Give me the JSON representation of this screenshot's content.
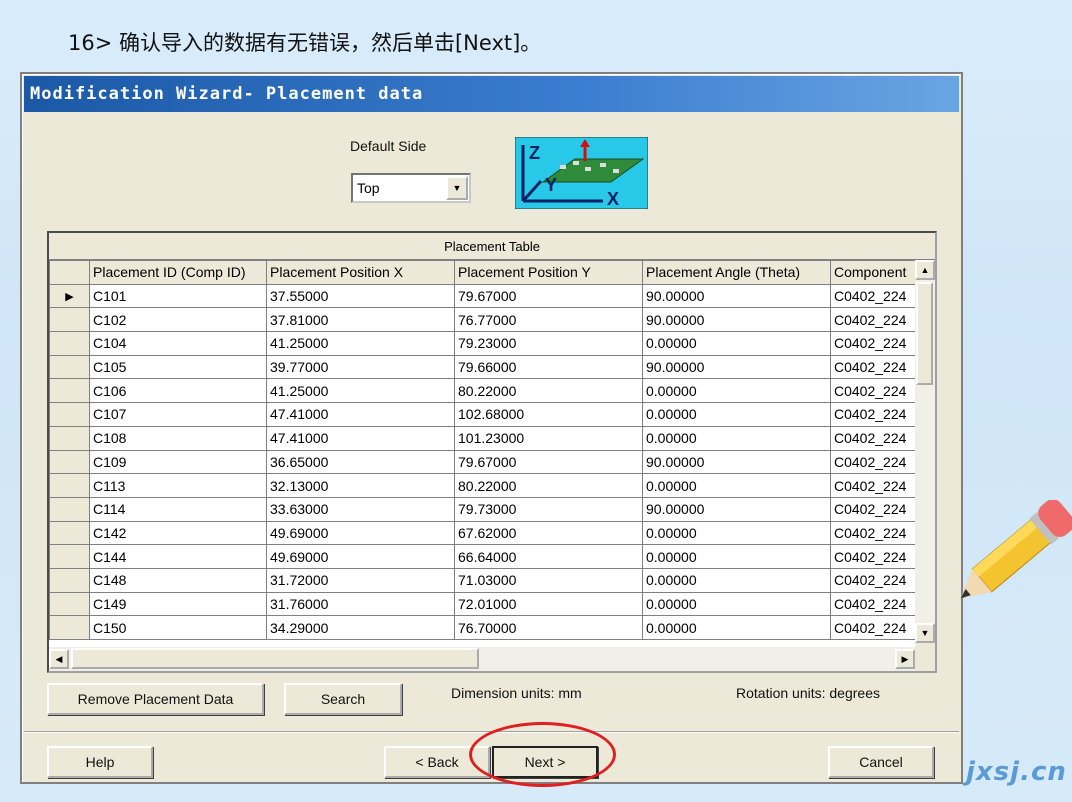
{
  "caption": "16> 确认导入的数据有无错误，然后单击[Next]。",
  "dialog": {
    "title": "Modification Wizard- Placement data",
    "default_side_label": "Default Side",
    "default_side_value": "Top",
    "axis_icon_labels": {
      "z": "Z",
      "y": "Y",
      "x": "X"
    }
  },
  "table": {
    "caption": "Placement Table",
    "columns": [
      "Placement ID (Comp ID)",
      "Placement Position X",
      "Placement Position Y",
      "Placement Angle (Theta)",
      "Component"
    ],
    "rows": [
      [
        "C101",
        "37.55000",
        "79.67000",
        "90.00000",
        "C0402_224"
      ],
      [
        "C102",
        "37.81000",
        "76.77000",
        "90.00000",
        "C0402_224"
      ],
      [
        "C104",
        "41.25000",
        "79.23000",
        "0.00000",
        "C0402_224"
      ],
      [
        "C105",
        "39.77000",
        "79.66000",
        "90.00000",
        "C0402_224"
      ],
      [
        "C106",
        "41.25000",
        "80.22000",
        "0.00000",
        "C0402_224"
      ],
      [
        "C107",
        "47.41000",
        "102.68000",
        "0.00000",
        "C0402_224"
      ],
      [
        "C108",
        "47.41000",
        "101.23000",
        "0.00000",
        "C0402_224"
      ],
      [
        "C109",
        "36.65000",
        "79.67000",
        "90.00000",
        "C0402_224"
      ],
      [
        "C113",
        "32.13000",
        "80.22000",
        "0.00000",
        "C0402_224"
      ],
      [
        "C114",
        "33.63000",
        "79.73000",
        "90.00000",
        "C0402_224"
      ],
      [
        "C142",
        "49.69000",
        "67.62000",
        "0.00000",
        "C0402_224"
      ],
      [
        "C144",
        "49.69000",
        "66.64000",
        "0.00000",
        "C0402_224"
      ],
      [
        "C148",
        "31.72000",
        "71.03000",
        "0.00000",
        "C0402_224"
      ],
      [
        "C149",
        "31.76000",
        "72.01000",
        "0.00000",
        "C0402_224"
      ],
      [
        "C150",
        "34.29000",
        "76.70000",
        "0.00000",
        "C0402_224"
      ]
    ]
  },
  "buttons": {
    "remove": "Remove Placement Data",
    "search": "Search",
    "help": "Help",
    "back": "< Back",
    "next": "Next >",
    "cancel": "Cancel"
  },
  "units": {
    "dimension": "Dimension units:  mm",
    "rotation": "Rotation units:  degrees"
  },
  "watermark": "jxsj.cn",
  "colors": {
    "title_bar": "#1b59a6",
    "highlight": "#e02020",
    "board": "#2e8b3a",
    "icon_bg": "#28c8e8"
  }
}
